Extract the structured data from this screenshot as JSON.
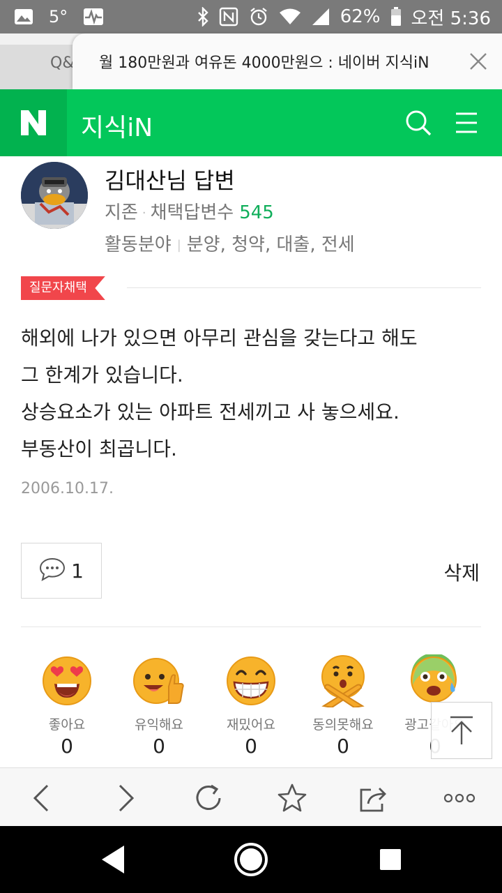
{
  "status_bar": {
    "temperature": "5°",
    "battery": "62%",
    "time": "오전 5:36"
  },
  "tabs": {
    "previous_tab_text": "Q&",
    "current_tab_title": "월 180만원과 여유돈 4000만원으 : 네이버 지식iN"
  },
  "header": {
    "logo": "N",
    "service_title": "지식iN"
  },
  "answerer": {
    "name": "김대산님 답변",
    "rank": "지존",
    "adopted_label": "채택답변수",
    "adopted_count": "545",
    "field_label": "활동분야",
    "fields": "분양, 청약, 대출, 전세"
  },
  "badge": "질문자채택",
  "answer": {
    "lines": [
      "해외에 나가 있으면 아무리 관심을 갖는다고 해도",
      "그 한계가 있습니다.",
      "상승요소가 있는 아파트 전세끼고 사 놓으세요.",
      "부동산이 최곱니다."
    ],
    "date": "2006.10.17."
  },
  "actions": {
    "comment_count": "1",
    "delete_label": "삭제"
  },
  "reactions": [
    {
      "label": "좋아요",
      "count": "0",
      "icon": "heart-eyes-emoji"
    },
    {
      "label": "유익해요",
      "count": "0",
      "icon": "thumbs-up-emoji"
    },
    {
      "label": "재밌어요",
      "count": "0",
      "icon": "grinning-emoji"
    },
    {
      "label": "동의못해요",
      "count": "0",
      "icon": "crossed-arms-emoji"
    },
    {
      "label": "광고같아요",
      "count": "0",
      "icon": "sick-sweat-emoji"
    }
  ],
  "colors": {
    "naver_green": "#03c75a",
    "badge_red": "#f1464b",
    "count_green": "#0fae5a"
  }
}
